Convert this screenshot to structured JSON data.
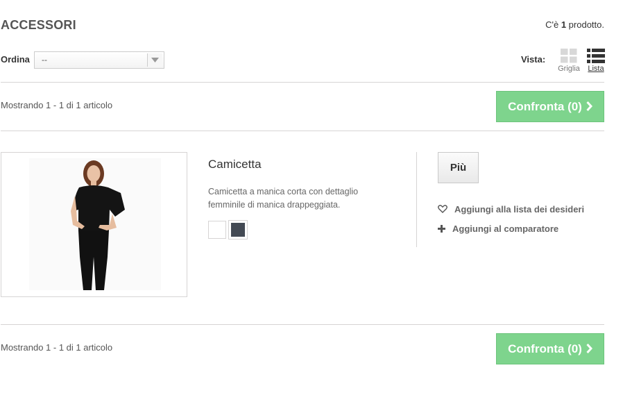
{
  "header": {
    "title": "ACCESSORI",
    "count_prefix": "C'è ",
    "count_value": "1",
    "count_suffix": " prodotto."
  },
  "toolbar": {
    "sort_label": "Ordina",
    "sort_value": "--",
    "view_label": "Vista:",
    "view_grid_label": "Griglia",
    "view_list_label": "Lista"
  },
  "pagination": {
    "showing_text": "Mostrando 1 - 1 di 1 articolo",
    "compare_label": "Confronta (0)"
  },
  "product": {
    "name": "Camicetta",
    "description": "Camicetta a manica corta con dettaglio femminile di manica drappeggiata.",
    "colors": [
      "#ffffff",
      "#434a54"
    ],
    "more_label": "Più",
    "wishlist_label": "Aggiungi alla lista dei desideri",
    "compare_add_label": "Aggiungi al comparatore"
  },
  "colors": {
    "accent_green": "#7ed48d",
    "divider": "#d6d4d4"
  }
}
